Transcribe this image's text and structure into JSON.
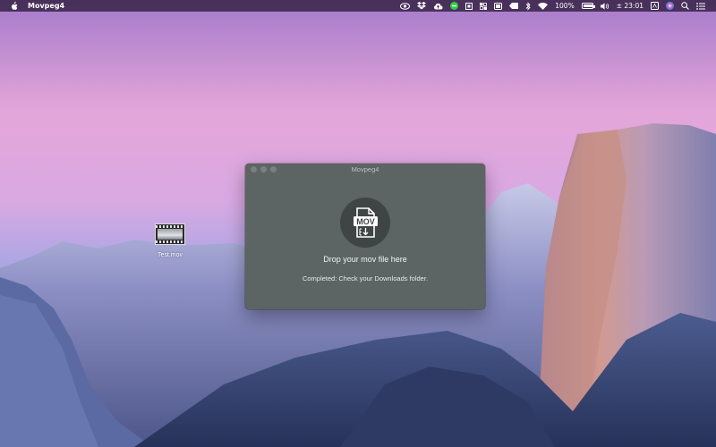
{
  "menubar": {
    "app_name": "Movpeg4",
    "battery_percent": "100%",
    "battery_level": 1.0,
    "clock": "± 23:01",
    "icons": [
      "apple-icon",
      "eye-icon",
      "dropbox-icon",
      "cloud-upload-icon",
      "green-app-icon",
      "screen-icon",
      "qr-icon",
      "display-icon",
      "tag-icon",
      "bluetooth-icon",
      "wifi-icon",
      "battery-icon",
      "volume-icon",
      "text-input-icon",
      "siri-icon",
      "search-icon",
      "list-icon"
    ]
  },
  "desktop": {
    "file_label": "Test.mov"
  },
  "window": {
    "title": "Movpeg4",
    "icon_label": "MOV",
    "drop_prompt": "Drop your mov file here",
    "status": "Completed: Check your Downloads folder."
  }
}
